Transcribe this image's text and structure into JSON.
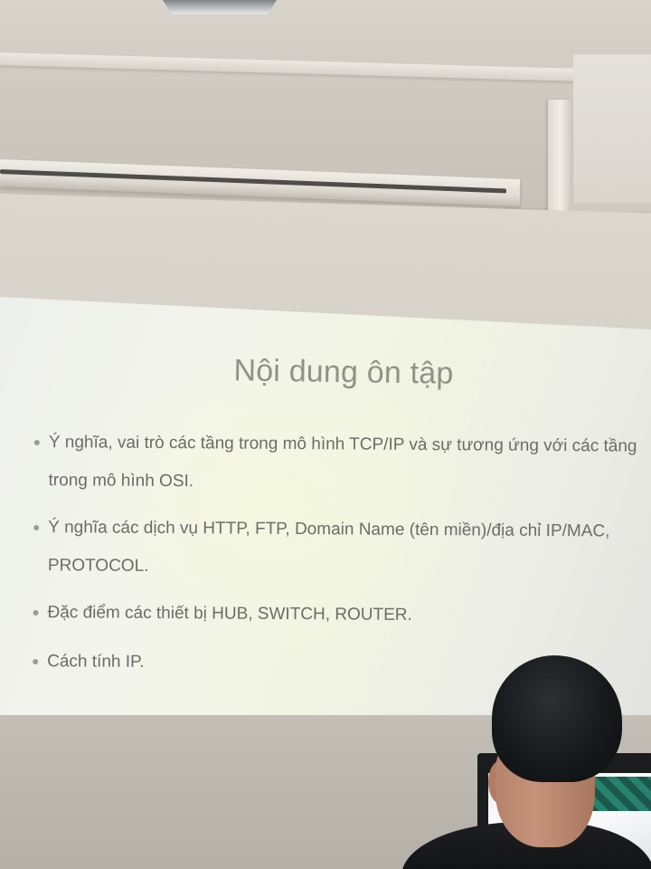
{
  "slide": {
    "title": "Nội dung ôn tập",
    "bullets": [
      "Ý nghĩa, vai trò các tầng trong mô hình TCP/IP và sự tương ứng với các tầng trong mô hình OSI.",
      "Ý nghĩa các dịch vụ HTTP, FTP, Domain Name (tên miền)/địa chỉ IP/MAC, PROTOCOL.",
      "Đặc điểm các thiết bị HUB, SWITCH, ROUTER.",
      "Cách tính IP."
    ]
  },
  "colors": {
    "slide_text": "#6a6d67",
    "slide_title": "#8f9286",
    "slide_background": "#eef1e6",
    "wall": "#bcb8af"
  }
}
